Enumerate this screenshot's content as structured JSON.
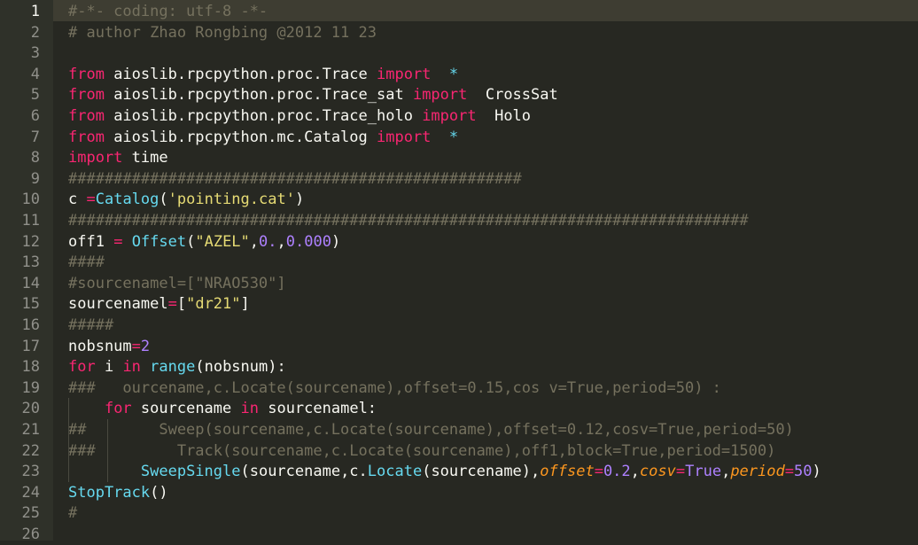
{
  "editor": {
    "line_numbers": [
      "1",
      "2",
      "3",
      "4",
      "5",
      "6",
      "7",
      "8",
      "9",
      "10",
      "11",
      "12",
      "13",
      "14",
      "15",
      "16",
      "17",
      "18",
      "19",
      "20",
      "21",
      "22",
      "23",
      "24",
      "25",
      "26"
    ],
    "colors": {
      "background": "#272822",
      "keyword": "#f92672",
      "comment": "#75715e",
      "string": "#e6db74",
      "number": "#ae81ff",
      "function": "#66d9ef",
      "parameter": "#fd971f",
      "plain": "#f8f8f2"
    },
    "lines": [
      [
        {
          "t": "#-*- coding: utf-8 -*-",
          "c": "cm"
        }
      ],
      [
        {
          "t": "# author Zhao Rongbing @2012 11 23",
          "c": "cm"
        }
      ],
      [],
      [
        {
          "t": "from",
          "c": "kw"
        },
        {
          "t": " aioslib.rpcpython.proc.Trace ",
          "c": "pl"
        },
        {
          "t": "import",
          "c": "kw"
        },
        {
          "t": "  ",
          "c": "pl"
        },
        {
          "t": "*",
          "c": "fn"
        }
      ],
      [
        {
          "t": "from",
          "c": "kw"
        },
        {
          "t": " aioslib.rpcpython.proc.Trace_sat ",
          "c": "pl"
        },
        {
          "t": "import",
          "c": "kw"
        },
        {
          "t": "  CrossSat",
          "c": "pl"
        }
      ],
      [
        {
          "t": "from",
          "c": "kw"
        },
        {
          "t": " aioslib.rpcpython.proc.Trace_holo ",
          "c": "pl"
        },
        {
          "t": "import",
          "c": "kw"
        },
        {
          "t": "  Holo",
          "c": "pl"
        }
      ],
      [
        {
          "t": "from",
          "c": "kw"
        },
        {
          "t": " aioslib.rpcpython.mc.Catalog ",
          "c": "pl"
        },
        {
          "t": "import",
          "c": "kw"
        },
        {
          "t": "  ",
          "c": "pl"
        },
        {
          "t": "*",
          "c": "fn"
        }
      ],
      [
        {
          "t": "import",
          "c": "kw"
        },
        {
          "t": " time",
          "c": "pl"
        }
      ],
      [
        {
          "t": "##################################################",
          "c": "cm"
        }
      ],
      [
        {
          "t": "c ",
          "c": "pl"
        },
        {
          "t": "=",
          "c": "op"
        },
        {
          "t": "Catalog",
          "c": "fn"
        },
        {
          "t": "(",
          "c": "pl"
        },
        {
          "t": "'pointing.cat'",
          "c": "str"
        },
        {
          "t": ")",
          "c": "pl"
        }
      ],
      [
        {
          "t": "###########################################################################",
          "c": "cm"
        }
      ],
      [
        {
          "t": "off1 ",
          "c": "pl"
        },
        {
          "t": "=",
          "c": "op"
        },
        {
          "t": " ",
          "c": "pl"
        },
        {
          "t": "Offset",
          "c": "fn"
        },
        {
          "t": "(",
          "c": "pl"
        },
        {
          "t": "\"AZEL\"",
          "c": "str"
        },
        {
          "t": ",",
          "c": "pl"
        },
        {
          "t": "0.",
          "c": "num"
        },
        {
          "t": ",",
          "c": "pl"
        },
        {
          "t": "0.000",
          "c": "num"
        },
        {
          "t": ")",
          "c": "pl"
        }
      ],
      [
        {
          "t": "####",
          "c": "cm"
        }
      ],
      [
        {
          "t": "#sourcenamel=[\"NRAO530\"]",
          "c": "cm"
        }
      ],
      [
        {
          "t": "sourcenamel",
          "c": "pl"
        },
        {
          "t": "=",
          "c": "op"
        },
        {
          "t": "[",
          "c": "pl"
        },
        {
          "t": "\"dr21\"",
          "c": "str"
        },
        {
          "t": "]",
          "c": "pl"
        }
      ],
      [
        {
          "t": "#####",
          "c": "cm"
        }
      ],
      [
        {
          "t": "nobsnum",
          "c": "pl"
        },
        {
          "t": "=",
          "c": "op"
        },
        {
          "t": "2",
          "c": "num"
        }
      ],
      [
        {
          "t": "for",
          "c": "kw"
        },
        {
          "t": " i ",
          "c": "pl"
        },
        {
          "t": "in",
          "c": "kw"
        },
        {
          "t": " ",
          "c": "pl"
        },
        {
          "t": "range",
          "c": "fn"
        },
        {
          "t": "(nobsnum):",
          "c": "pl"
        }
      ],
      [
        {
          "t": "###   ourcename,c.Locate(sourcename),offset=0.15,cos v=True,period=50) :",
          "c": "cm"
        }
      ],
      [
        {
          "t": "    ",
          "c": "pl"
        },
        {
          "t": "for",
          "c": "kw"
        },
        {
          "t": " sourcename ",
          "c": "pl"
        },
        {
          "t": "in",
          "c": "kw"
        },
        {
          "t": " sourcenamel:",
          "c": "pl"
        }
      ],
      [
        {
          "t": "##        Sweep(sourcename,c.Locate(sourcename),offset=0.12,cosv=True,period=50)",
          "c": "cm"
        }
      ],
      [
        {
          "t": "###         Track(sourcename,c.Locate(sourcename),off1,block=True,period=1500)",
          "c": "cm"
        }
      ],
      [
        {
          "t": "        ",
          "c": "pl"
        },
        {
          "t": "SweepSingle",
          "c": "fn"
        },
        {
          "t": "(sourcename,c.",
          "c": "pl"
        },
        {
          "t": "Locate",
          "c": "fn"
        },
        {
          "t": "(sourcename),",
          "c": "pl"
        },
        {
          "t": "offset",
          "c": "param"
        },
        {
          "t": "=",
          "c": "op"
        },
        {
          "t": "0.2",
          "c": "num"
        },
        {
          "t": ",",
          "c": "pl"
        },
        {
          "t": "cosv",
          "c": "param"
        },
        {
          "t": "=",
          "c": "op"
        },
        {
          "t": "True",
          "c": "num"
        },
        {
          "t": ",",
          "c": "pl"
        },
        {
          "t": "period",
          "c": "param"
        },
        {
          "t": "=",
          "c": "op"
        },
        {
          "t": "50",
          "c": "num"
        },
        {
          "t": ")",
          "c": "pl"
        }
      ],
      [
        {
          "t": "StopTrack",
          "c": "fn"
        },
        {
          "t": "()",
          "c": "pl"
        }
      ],
      [
        {
          "t": "#",
          "c": "cm"
        }
      ],
      []
    ]
  }
}
